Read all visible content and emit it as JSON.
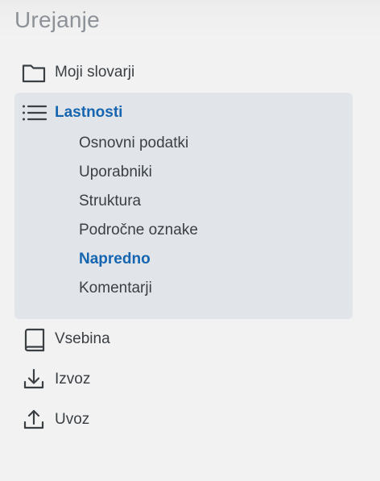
{
  "header": {
    "title": "Urejanje"
  },
  "nav": {
    "my_dictionaries": {
      "label": "Moji slovarji",
      "icon": "folder-icon"
    },
    "properties": {
      "label": "Lastnosti",
      "icon": "list-icon",
      "expanded": true,
      "subitems": [
        {
          "label": "Osnovni podatki",
          "active": false
        },
        {
          "label": "Uporabniki",
          "active": false
        },
        {
          "label": "Struktura",
          "active": false
        },
        {
          "label": "Področne oznake",
          "active": false
        },
        {
          "label": "Napredno",
          "active": true
        },
        {
          "label": "Komentarji",
          "active": false
        }
      ]
    },
    "content": {
      "label": "Vsebina",
      "icon": "book-icon"
    },
    "export": {
      "label": "Izvoz",
      "icon": "download-icon"
    },
    "import": {
      "label": "Uvoz",
      "icon": "upload-icon"
    }
  },
  "colors": {
    "accent": "#1565b0",
    "group_background": "#e1e5e9",
    "page_background": "#f2f2f2",
    "title": "#8d9298"
  }
}
